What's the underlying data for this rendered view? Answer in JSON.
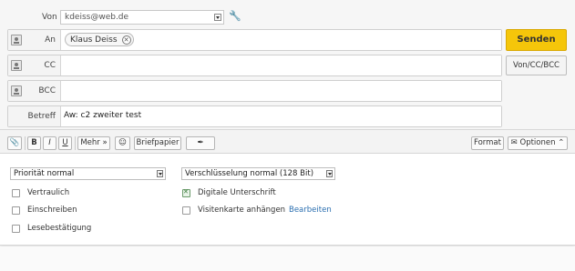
{
  "from": {
    "label": "Von",
    "value": "kdeiss@web.de"
  },
  "to": {
    "label": "An",
    "recipients": [
      {
        "name": "Klaus Deiss"
      }
    ]
  },
  "cc": {
    "label": "CC",
    "value": ""
  },
  "bcc": {
    "label": "BCC",
    "value": ""
  },
  "subject": {
    "label": "Betreff",
    "value": "Aw: c2 zweiter test"
  },
  "buttons": {
    "send": "Senden",
    "von_cc_bcc": "Von/CC/BCC"
  },
  "toolbar": {
    "bold": "B",
    "italic": "I",
    "underline": "U",
    "mehr": "Mehr",
    "briefpapier": "Briefpapier",
    "format": "Format",
    "optionen": "Optionen"
  },
  "options": {
    "priority": {
      "selected": "Priorität normal"
    },
    "encryption": {
      "selected": "Verschlüsselung normal (128 Bit)"
    },
    "checkboxes_left": [
      {
        "label": "Vertraulich",
        "checked": false
      },
      {
        "label": "Einschreiben",
        "checked": false
      },
      {
        "label": "Lesebestätigung",
        "checked": false
      }
    ],
    "checkboxes_right": [
      {
        "label": "Digitale Unterschrift",
        "checked": true
      },
      {
        "label": "Visitenkarte anhängen",
        "checked": false
      }
    ],
    "edit_link": "Bearbeiten"
  },
  "colors": {
    "send_button": "#f5c60a",
    "link": "#2b6fb0",
    "checked_box": "#3a7a3a"
  }
}
